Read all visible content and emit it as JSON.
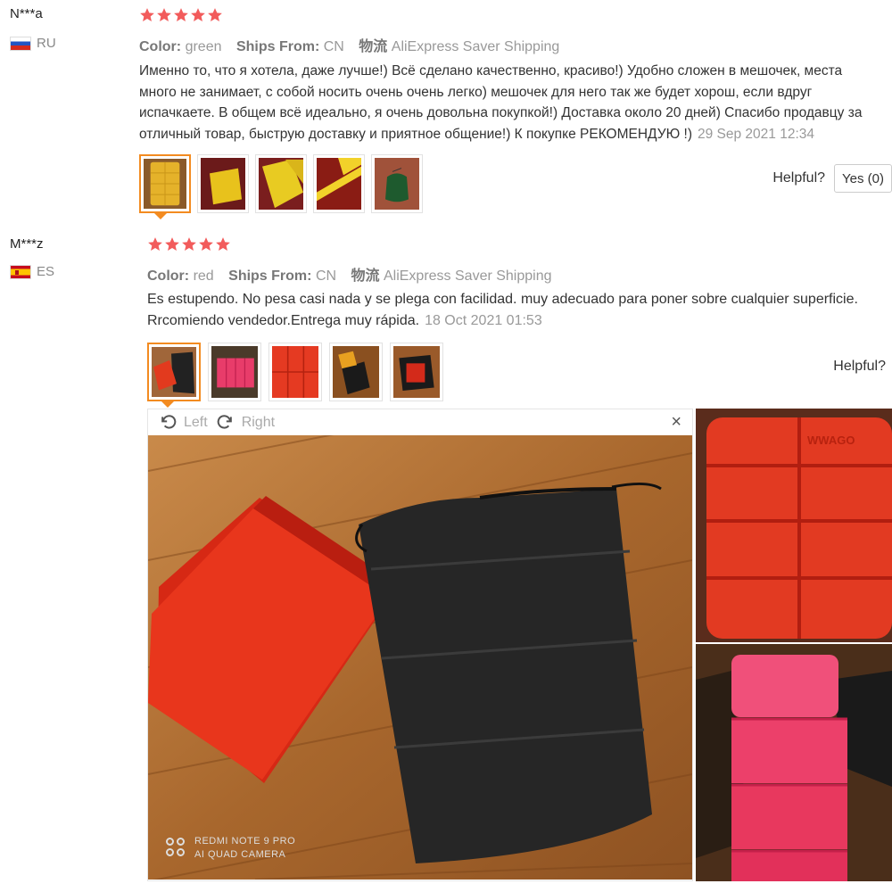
{
  "colors": {
    "star": "#f25b5b",
    "accent": "#f38b20"
  },
  "reviews": [
    {
      "user": "N***a",
      "country": "RU",
      "stars": 5,
      "color_label": "Color:",
      "color_value": "green",
      "ships_label": "Ships From:",
      "ships_value": "CN",
      "shipping_label": "物流",
      "shipping_value": "AliExpress Saver Shipping",
      "text": "Именно то, что я хотела, даже лучше!) Всё сделано качественно, красиво!) Удобно сложен в мешочек, места много не занимает, с собой носить очень очень легко) мешочек для него так же будет хорош, если вдруг испачкаете. В общем всё идеально, я очень довольна покупкой!) Доставка около 20 дней) Спасибо продавцу за отличный товар, быструю доставку и приятное общение!) К покупке РЕКОМЕНДУЮ !)",
      "date": "29 Sep 2021 12:34",
      "helpful_label": "Helpful?",
      "yes_label": "Yes (0)"
    },
    {
      "user": "M***z",
      "country": "ES",
      "stars": 5,
      "color_label": "Color:",
      "color_value": "red",
      "ships_label": "Ships From:",
      "ships_value": "CN",
      "shipping_label": "物流",
      "shipping_value": "AliExpress Saver Shipping",
      "text": "Es estupendo. No pesa casi nada y se plega con facilidad. muy adecuado para poner sobre cualquier superficie. Rrcomiendo vendedor.Entrega muy rápida.",
      "date": "18 Oct 2021 01:53",
      "helpful_label": "Helpful?"
    }
  ],
  "viewer": {
    "rotate_left": "Left",
    "rotate_right": "Right",
    "close_icon": "×",
    "camera_line1": "REDMI NOTE 9 PRO",
    "camera_line2": "AI QUAD CAMERA"
  },
  "side_photo": {
    "brand_text": "WWAGO"
  }
}
